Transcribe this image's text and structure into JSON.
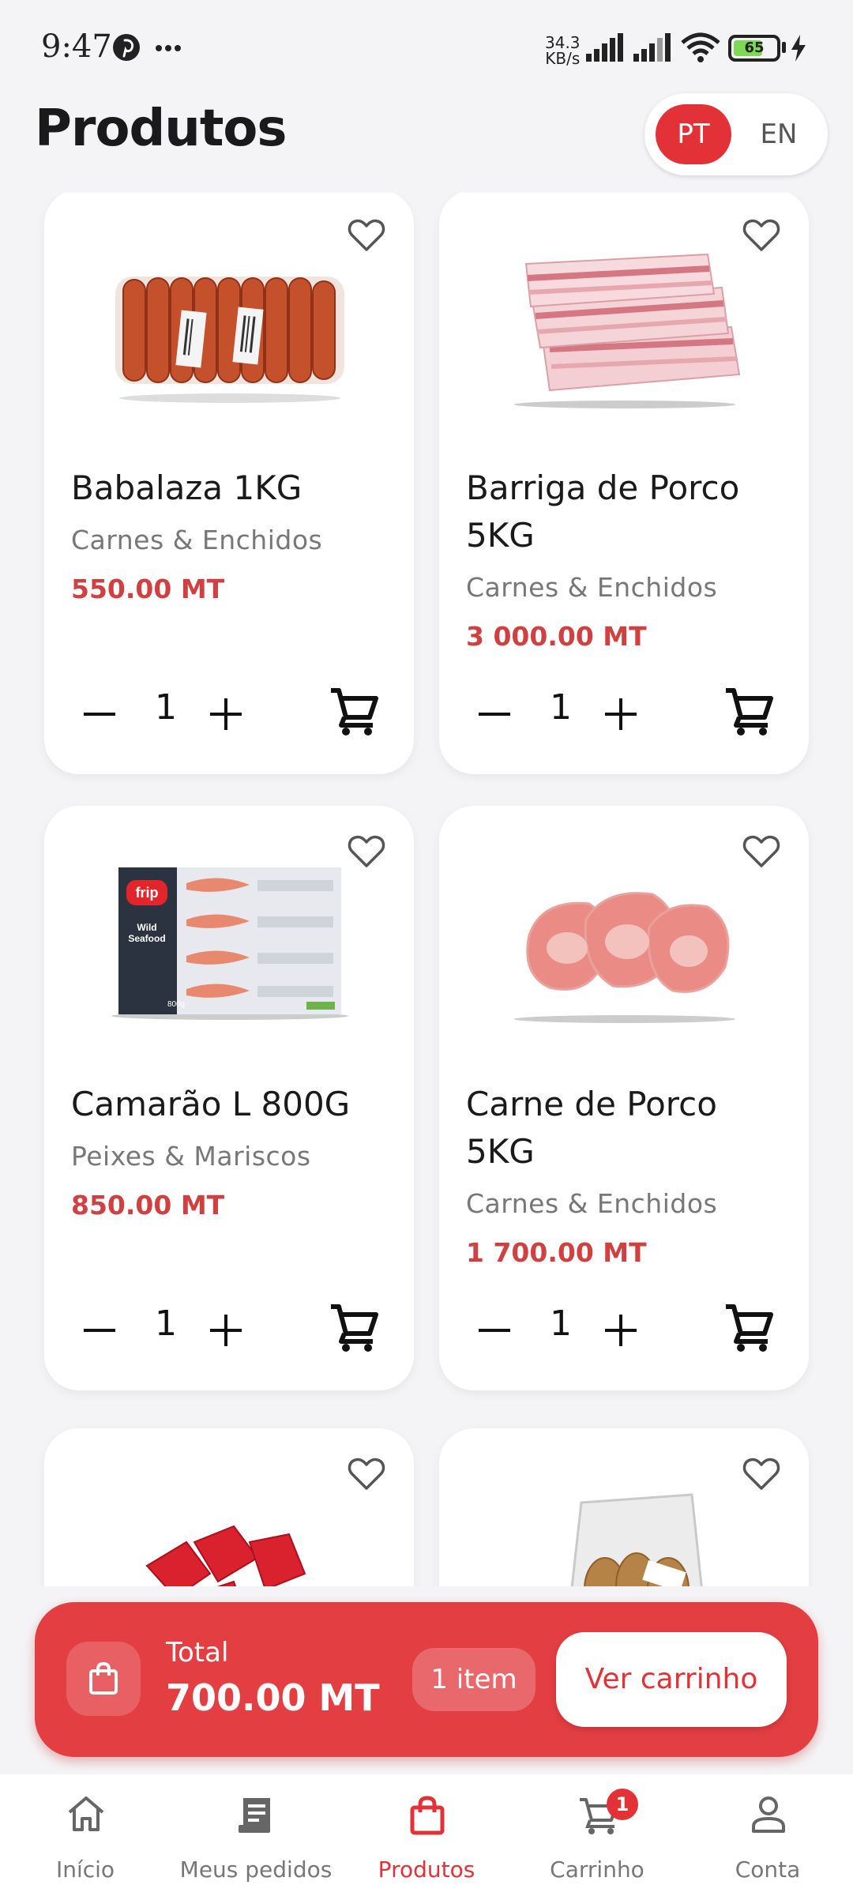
{
  "status_bar": {
    "time": "9:47",
    "network_speed_value": "34.3",
    "network_speed_unit": "KB/s",
    "battery": "65"
  },
  "header": {
    "title": "Produtos",
    "languages": [
      "PT",
      "EN"
    ],
    "active_language": "PT"
  },
  "products": [
    {
      "name": "Babalaza 1KG",
      "category": "Carnes & Enchidos",
      "price": "550.00 MT",
      "quantity": "1",
      "image": "sausages-pack"
    },
    {
      "name": "Barriga de Porco 5KG",
      "category": "Carnes & Enchidos",
      "price": "3 000.00 MT",
      "quantity": "1",
      "image": "pork-belly"
    },
    {
      "name": "Camarão L 800G",
      "category": "Peixes & Mariscos",
      "price": "850.00 MT",
      "quantity": "1",
      "image": "shrimp-box",
      "image_text": {
        "brand": "frip",
        "line1": "Wild",
        "line2": "Seafood",
        "weight": "800g"
      }
    },
    {
      "name": "Carne de Porco 5KG",
      "category": "Carnes & Enchidos",
      "price": "1 700.00 MT",
      "quantity": "1",
      "image": "pork-chops"
    },
    {
      "image": "beef-cubes"
    },
    {
      "image": "vacuum-pack"
    }
  ],
  "cart_summary": {
    "total_label": "Total",
    "total_amount": "700.00 MT",
    "item_count": "1 item",
    "view_cart_label": "Ver carrinho"
  },
  "bottom_nav": [
    {
      "label": "Início",
      "icon": "home-icon"
    },
    {
      "label": "Meus pedidos",
      "icon": "receipt-icon"
    },
    {
      "label": "Produtos",
      "icon": "shopping-bag-icon",
      "active": true
    },
    {
      "label": "Carrinho",
      "icon": "cart-icon",
      "badge": "1"
    },
    {
      "label": "Conta",
      "icon": "person-icon"
    }
  ],
  "colors": {
    "accent": "#e33237",
    "price": "#d04040",
    "background": "#f4f4f6"
  }
}
